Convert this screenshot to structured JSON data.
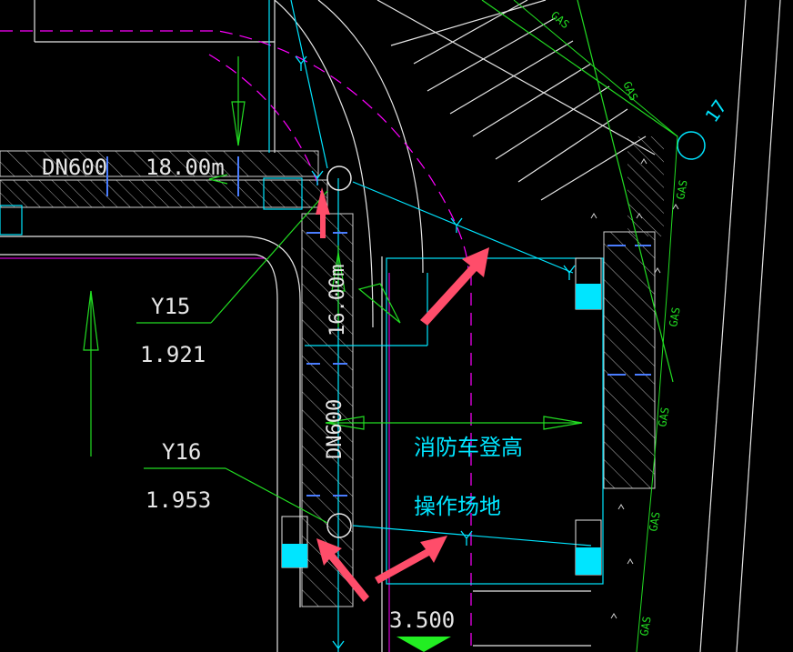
{
  "drawing": {
    "pipe_horizontal": {
      "diameter": "DN600",
      "length": "18.00m"
    },
    "pipe_vertical": {
      "diameter": "DN600",
      "length": "16.00m"
    },
    "manholes": [
      {
        "id": "Y15",
        "elevation": "1.921"
      },
      {
        "id": "Y16",
        "elevation": "1.953"
      }
    ],
    "site_label_line1": "消防车登高",
    "site_label_line2": "操作场地",
    "spot_elevation": "3.500",
    "gas_label": "GAS",
    "node_number": "17",
    "colors": {
      "background": "#000000",
      "cyan": "#00ffff",
      "green": "#00ff00",
      "white": "#ffffff",
      "magenta": "#ff00ff",
      "highlight_arrow": "#ff4d6a"
    }
  }
}
